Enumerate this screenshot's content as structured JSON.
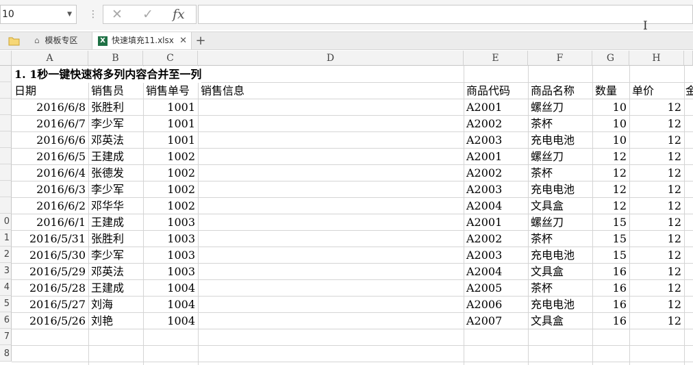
{
  "formula_bar": {
    "name_box": "10",
    "cancel_icon": "✕",
    "confirm_icon": "✓",
    "fx_label": "fx",
    "formula_value": ""
  },
  "tabs": {
    "template_label": "模板专区",
    "file_label": "快速填充11.xlsx",
    "close_icon": "✕",
    "add_icon": "+"
  },
  "columns": [
    "A",
    "B",
    "C",
    "D",
    "E",
    "F",
    "G",
    "H"
  ],
  "row_numbers": [
    "",
    "",
    "",
    "",
    "",
    "",
    "",
    "",
    "",
    "0",
    "1",
    "2",
    "3",
    "4",
    "5",
    "6",
    "7",
    "8"
  ],
  "sheet": {
    "title": "1. 1秒一键快速将多列内容合并至一列",
    "headers": {
      "date": "日期",
      "seller": "销售员",
      "order": "销售单号",
      "info": "销售信息",
      "code": "商品代码",
      "name": "商品名称",
      "qty": "数量",
      "price": "单价",
      "amount": "金"
    },
    "rows": [
      {
        "date": "2016/6/8",
        "seller": "张胜利",
        "order": "1001",
        "code": "A2001",
        "name": "螺丝刀",
        "qty": "10",
        "price": "12"
      },
      {
        "date": "2016/6/7",
        "seller": "李少军",
        "order": "1001",
        "code": "A2002",
        "name": "茶杯",
        "qty": "10",
        "price": "12"
      },
      {
        "date": "2016/6/6",
        "seller": "邓英法",
        "order": "1001",
        "code": "A2003",
        "name": "充电电池",
        "qty": "10",
        "price": "12"
      },
      {
        "date": "2016/6/5",
        "seller": "王建成",
        "order": "1002",
        "code": "A2001",
        "name": "螺丝刀",
        "qty": "12",
        "price": "12"
      },
      {
        "date": "2016/6/4",
        "seller": "张德发",
        "order": "1002",
        "code": "A2002",
        "name": "茶杯",
        "qty": "12",
        "price": "12"
      },
      {
        "date": "2016/6/3",
        "seller": "李少军",
        "order": "1002",
        "code": "A2003",
        "name": "充电电池",
        "qty": "12",
        "price": "12"
      },
      {
        "date": "2016/6/2",
        "seller": "邓华华",
        "order": "1002",
        "code": "A2004",
        "name": "文具盒",
        "qty": "12",
        "price": "12"
      },
      {
        "date": "2016/6/1",
        "seller": "王建成",
        "order": "1003",
        "code": "A2001",
        "name": "螺丝刀",
        "qty": "15",
        "price": "12"
      },
      {
        "date": "2016/5/31",
        "seller": "张胜利",
        "order": "1003",
        "code": "A2002",
        "name": "茶杯",
        "qty": "15",
        "price": "12"
      },
      {
        "date": "2016/5/30",
        "seller": "李少军",
        "order": "1003",
        "code": "A2003",
        "name": "充电电池",
        "qty": "15",
        "price": "12"
      },
      {
        "date": "2016/5/29",
        "seller": "邓英法",
        "order": "1003",
        "code": "A2004",
        "name": "文具盒",
        "qty": "16",
        "price": "12"
      },
      {
        "date": "2016/5/28",
        "seller": "王建成",
        "order": "1004",
        "code": "A2005",
        "name": "茶杯",
        "qty": "16",
        "price": "12"
      },
      {
        "date": "2016/5/27",
        "seller": "刘海",
        "order": "1004",
        "code": "A2006",
        "name": "充电电池",
        "qty": "16",
        "price": "12"
      },
      {
        "date": "2016/5/26",
        "seller": "刘艳",
        "order": "1004",
        "code": "A2007",
        "name": "文具盒",
        "qty": "16",
        "price": "12"
      }
    ]
  }
}
